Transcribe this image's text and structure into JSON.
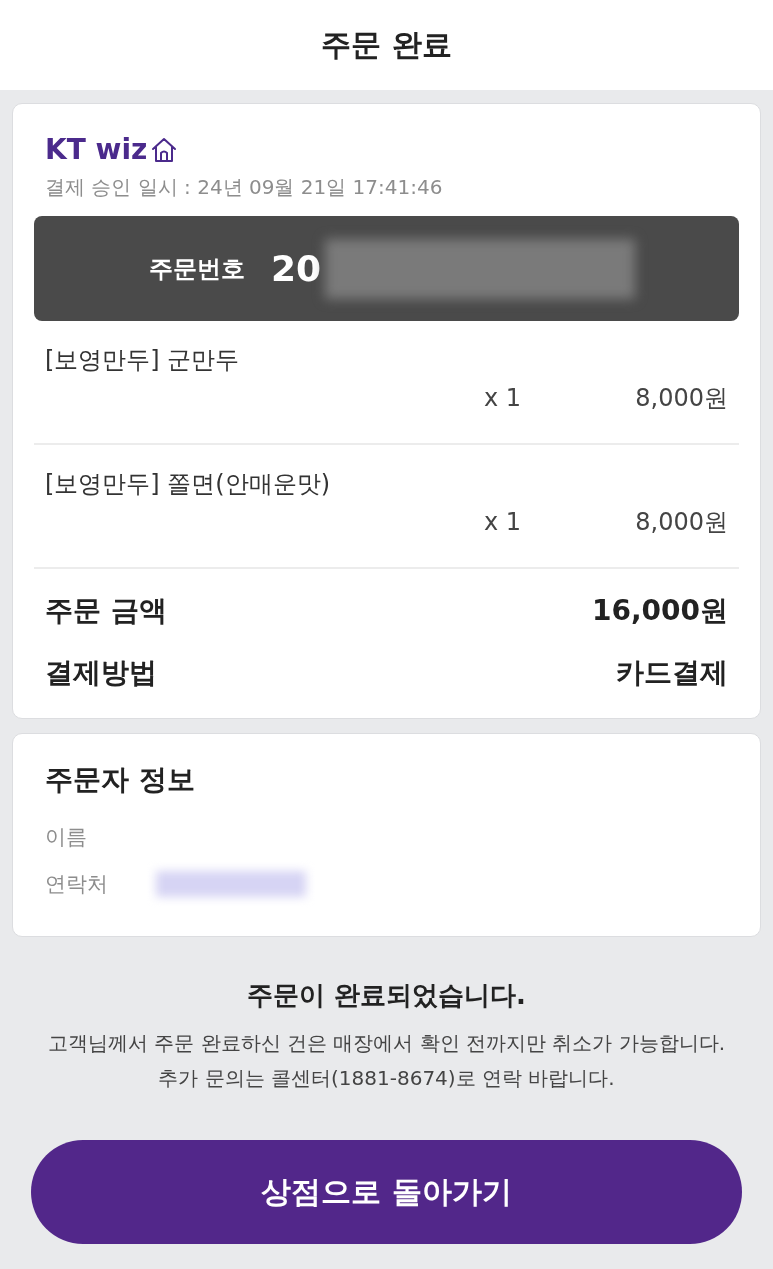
{
  "header": {
    "title": "주문 완료"
  },
  "order": {
    "store_name": "KT wiz",
    "approval_time": "결제 승인 일시 : 24년 09월 21일 17:41:46",
    "order_number": {
      "label": "주문번호",
      "value": "20",
      "redacted": true
    },
    "items": [
      {
        "name": "[보영만두] 군만두",
        "quantity": "x 1",
        "price": "8,000원"
      },
      {
        "name": "[보영만두] 쫄면(안매운맛)",
        "quantity": "x 1",
        "price": "8,000원"
      }
    ],
    "summary": [
      {
        "label": "주문 금액",
        "value": "16,000원"
      },
      {
        "label": "결제방법",
        "value": "카드결제"
      }
    ]
  },
  "customer": {
    "title": "주문자 정보",
    "fields": [
      {
        "label": "이름",
        "redacted": false
      },
      {
        "label": "연락처",
        "redacted": true
      }
    ]
  },
  "message": {
    "title": "주문이 완료되었습니다.",
    "lines": [
      "고객님께서 주문 완료하신 건은 매장에서 확인 전까지만 취소가 가능합니다.",
      "추가 문의는 콜센터(1881-8674)로 연락 바랍니다."
    ]
  },
  "button": {
    "label": "상점으로 돌아가기"
  }
}
